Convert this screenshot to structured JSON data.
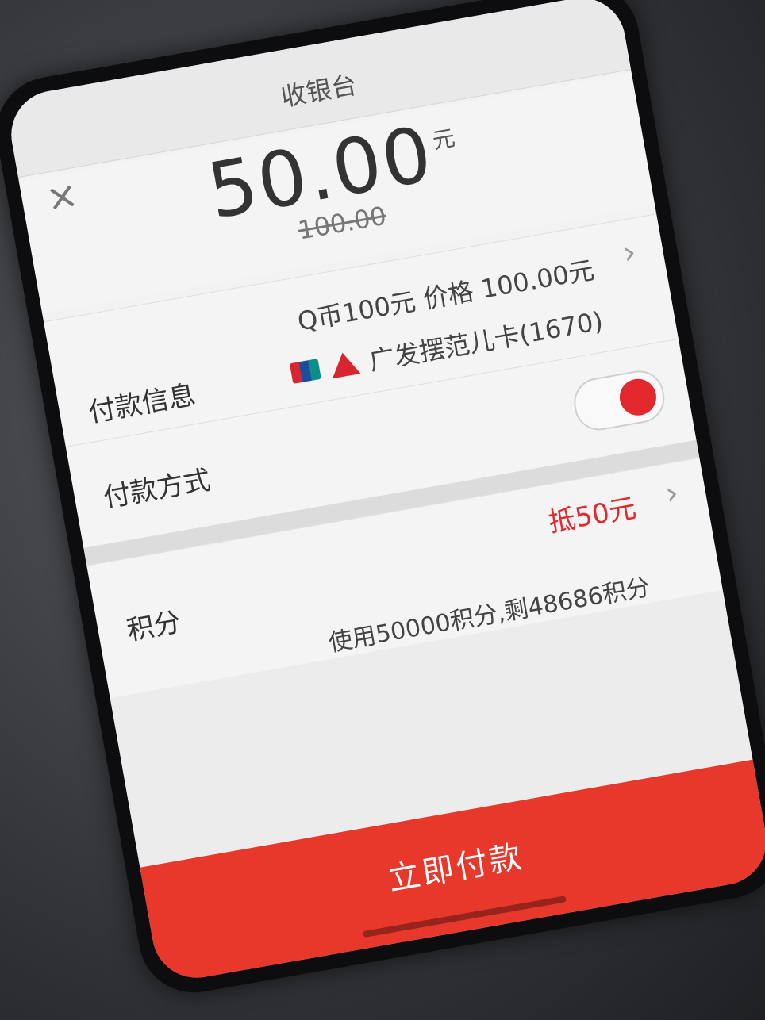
{
  "header": {
    "title": "收银台",
    "close_icon": "×"
  },
  "amount": {
    "value": "50.00",
    "unit": "元",
    "original": "100.00"
  },
  "payment_info": {
    "label": "付款信息",
    "description": "Q币100元 价格 100.00元",
    "chevron": "›"
  },
  "card": {
    "unionpay_icon": "unionpay-icon",
    "bank_icon": "cgb-bank-icon",
    "name": "广发摆范儿卡(1670)"
  },
  "payment_method": {
    "label": "付款方式",
    "toggle_on": true
  },
  "points": {
    "label": "积分",
    "deduct": "抵50元",
    "detail": "使用50000积分,剩48686积分",
    "chevron": "›",
    "accent_color": "#e3282e"
  },
  "pay_button": {
    "label": "立即付款",
    "color": "#e8382c"
  }
}
